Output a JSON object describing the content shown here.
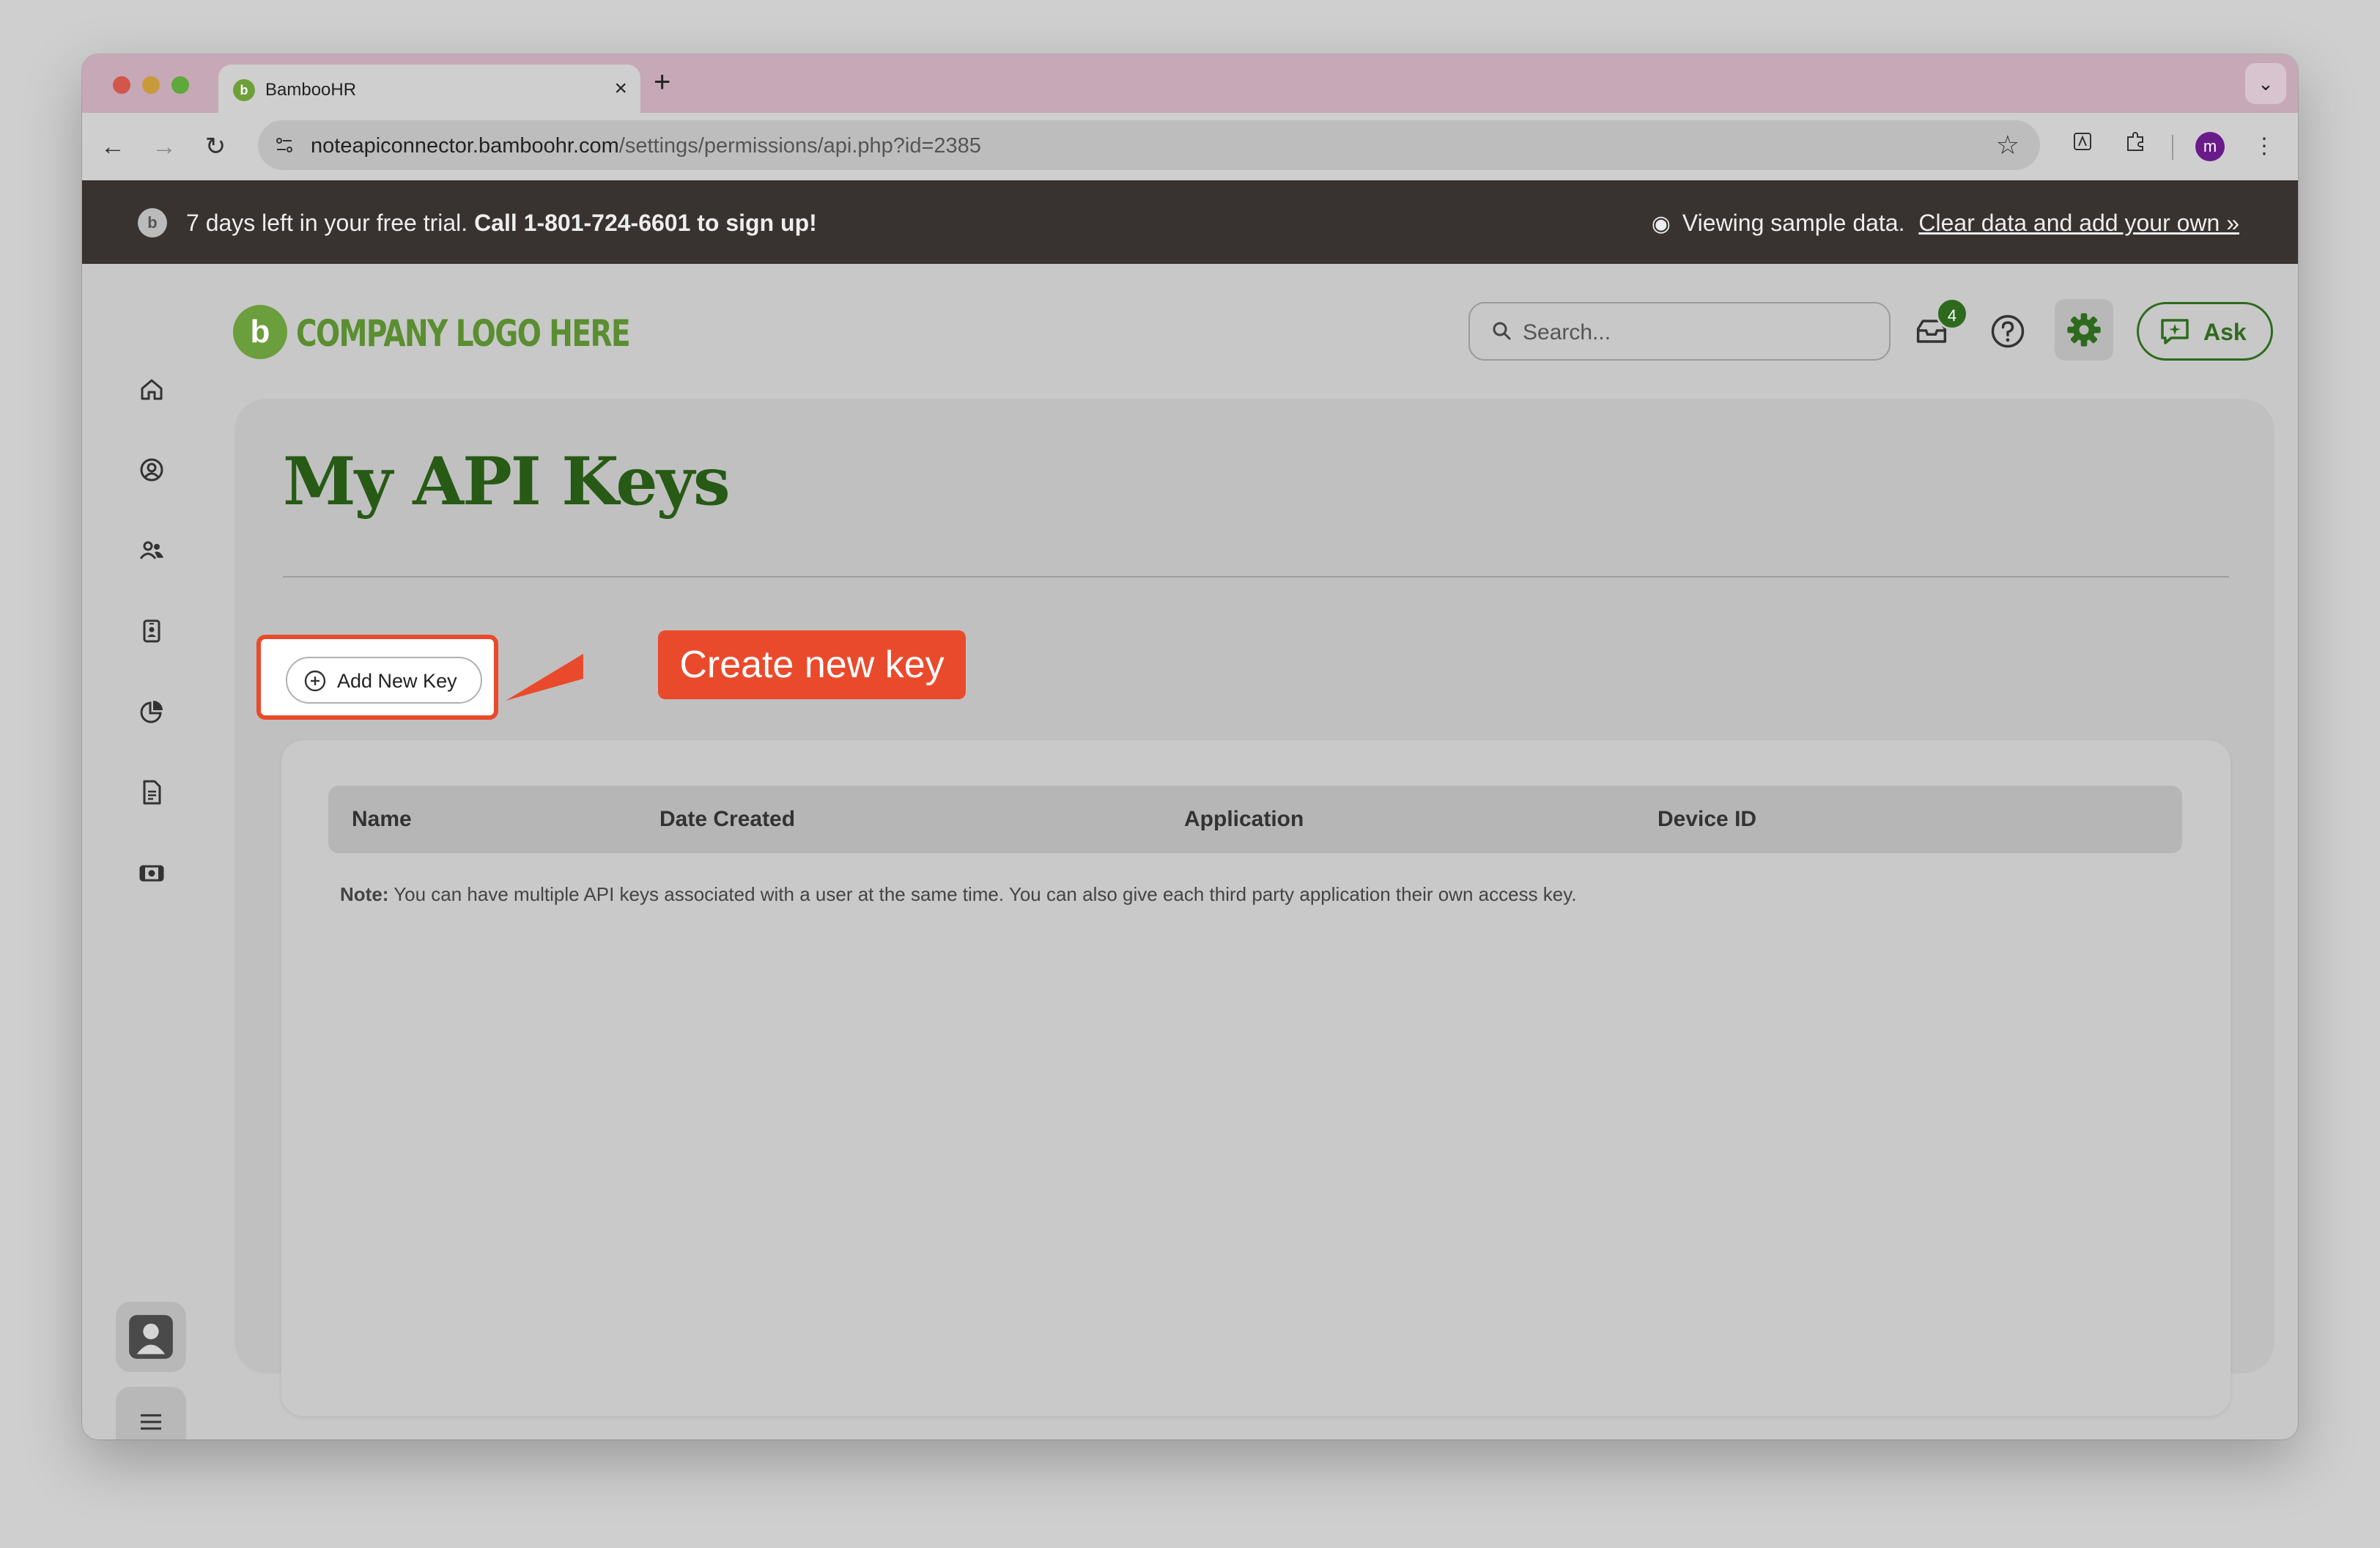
{
  "browser": {
    "tab_title": "BambooHR",
    "tab_favicon_letter": "b",
    "tab_close": "×",
    "new_tab": "+",
    "tab_menu": "⌄",
    "url_host": "noteapiconnector.bamboohr.com",
    "url_path": "/settings/permissions/api.php?id=2385",
    "profile_initial": "m"
  },
  "banner": {
    "trial_text": "7 days left in your free trial.",
    "call_text": "Call 1-801-724-6601 to sign up!",
    "sample_text": "Viewing sample data.",
    "clear_link": "Clear data and add your own »"
  },
  "header": {
    "logo_text": "COMPANY LOGO HERE",
    "search_placeholder": "Search...",
    "inbox_count": "4",
    "ask_label": "Ask"
  },
  "page": {
    "title": "My API Keys",
    "add_key_label": "Add New Key",
    "callout_text": "Create new key"
  },
  "table": {
    "columns": [
      "Name",
      "Date Created",
      "Application",
      "Device ID"
    ],
    "note_label": "Note:",
    "note_text": " You can have multiple API keys associated with a user at the same time. You can also give each third party application their own access key."
  },
  "colors": {
    "brand_green": "#275a15",
    "logo_green": "#6b9e3c",
    "callout_red": "#ea4a2c",
    "banner_bg": "#383230"
  },
  "icons": {
    "sidebar": [
      "home-icon",
      "person-circle-icon",
      "people-icon",
      "id-badge-icon",
      "pie-chart-icon",
      "document-icon",
      "money-icon"
    ],
    "header": [
      "search-icon",
      "inbox-icon",
      "help-icon",
      "gear-icon",
      "ask-chat-icon"
    ]
  }
}
